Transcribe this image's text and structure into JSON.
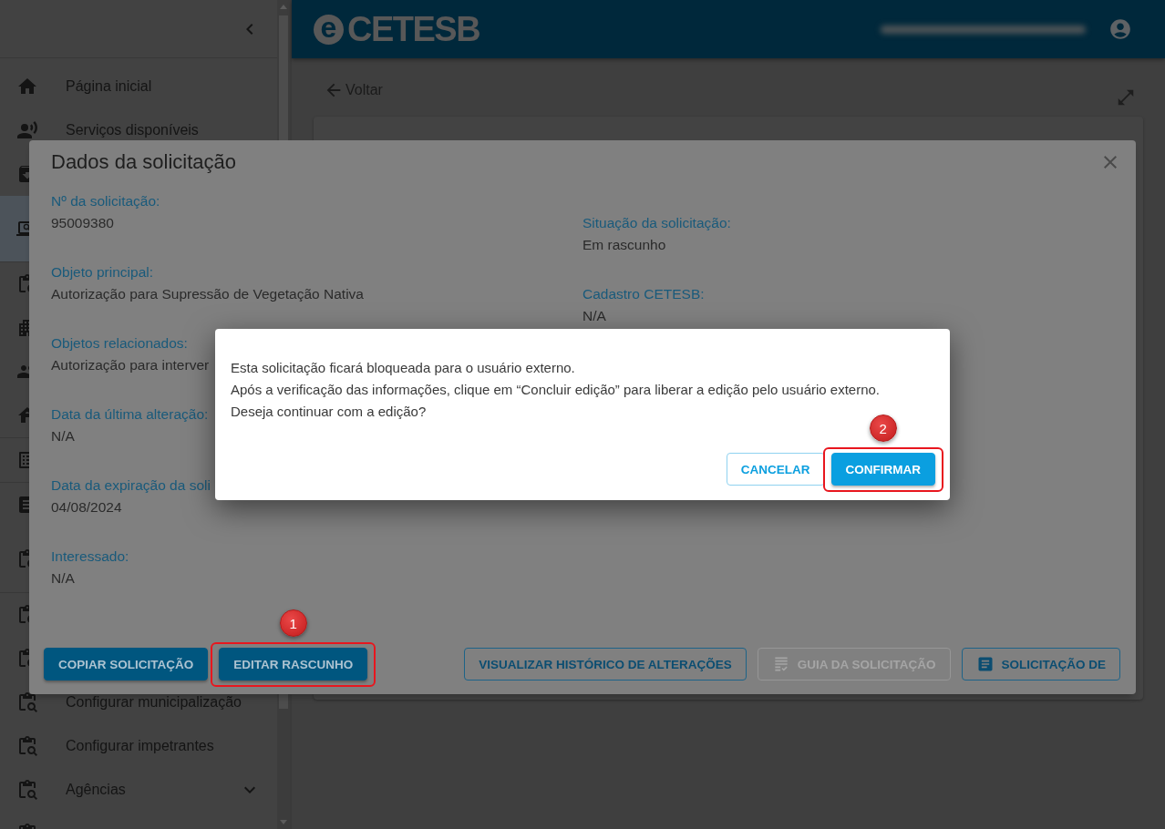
{
  "sidebar": {
    "groups": [
      {
        "items": [
          {
            "label": "Página inicial",
            "selected": false,
            "kind": "normal"
          },
          {
            "label": "Serviços disponíveis",
            "selected": false,
            "kind": "normal"
          },
          {
            "selected": false,
            "kind": "normal"
          },
          {
            "selected": true,
            "kind": "tall"
          }
        ]
      },
      {
        "items": [
          {
            "selected": false,
            "kind": "normal"
          },
          {
            "selected": false,
            "kind": "normal"
          },
          {
            "selected": false,
            "kind": "normal"
          },
          {
            "selected": false,
            "kind": "normal"
          }
        ]
      },
      {
        "items": [
          {
            "selected": false,
            "kind": "normal"
          }
        ]
      },
      {
        "items": [
          {
            "selected": false,
            "kind": "normal"
          },
          {
            "selected": false,
            "kind": "tall"
          }
        ]
      },
      {
        "items": [
          {
            "selected": false,
            "kind": "normal"
          },
          {
            "selected": false,
            "kind": "normal"
          },
          {
            "label": "Configurar municipalização",
            "selected": false,
            "kind": "normal"
          },
          {
            "label": "Configurar impetrantes",
            "selected": false,
            "kind": "normal"
          },
          {
            "label": "Agências",
            "selected": false,
            "kind": "normal",
            "expanded": false
          },
          {
            "selected": false,
            "kind": "normal"
          }
        ]
      }
    ]
  },
  "header": {
    "logo": {
      "mark": "e",
      "name": "CETESB"
    }
  },
  "page": {
    "back_link": "Voltar"
  },
  "details_dialog": {
    "title": "Dados da solicitação",
    "left_fields": [
      {
        "label": "Nº da solicitação:",
        "value": "95009380"
      },
      {
        "label": "Objeto principal:",
        "value": "Autorização para Supressão de Vegetação Nativa"
      },
      {
        "label": "Objetos relacionados:",
        "value": "Autorização para interver"
      },
      {
        "label": "Data da última alteração:",
        "value": "N/A"
      },
      {
        "label": "Data da expiração da soli",
        "value": "04/08/2024"
      },
      {
        "label": "Interessado:",
        "value": "N/A"
      }
    ],
    "right_fields": [
      {
        "label": "Situação da solicitação:",
        "value": "Em rascunho"
      },
      {
        "label": "Cadastro CETESB:",
        "value": "N/A"
      }
    ],
    "left_actions": [
      {
        "label": "COPIAR SOLICITAÇÃO",
        "kind": "filled",
        "disabled": false
      },
      {
        "label": "EDITAR RASCUNHO",
        "kind": "filled",
        "disabled": false,
        "step": "1"
      }
    ],
    "right_actions": [
      {
        "label": "VISUALIZAR HISTÓRICO DE ALTERAÇÕES",
        "kind": "outlined",
        "disabled": false
      },
      {
        "label": "GUIA DA SOLICITAÇÃO",
        "kind": "outlined",
        "disabled": true
      },
      {
        "label": "SOLICITAÇÃO DE",
        "kind": "outlined",
        "disabled": false
      }
    ]
  },
  "confirm_dialog": {
    "lines": [
      "Esta solicitação ficará bloqueada para o usuário externo.",
      "Após a verificação das informações, clique em “Concluir edição” para liberar a edição pelo usuário externo.",
      "Deseja continuar com a edição?"
    ],
    "actions": [
      {
        "label": "CANCELAR",
        "kind": "outlined",
        "disabled": false
      },
      {
        "label": "CONFIRMAR",
        "kind": "filled",
        "disabled": false,
        "step": "2"
      }
    ]
  }
}
